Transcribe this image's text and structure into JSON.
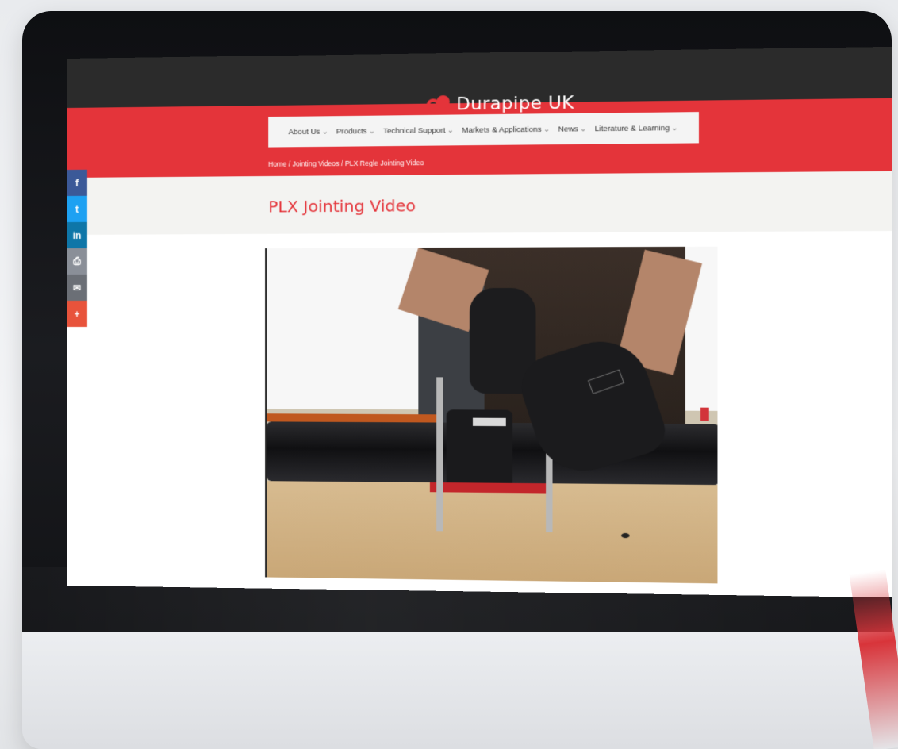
{
  "header": {
    "brand_name": "Durapipe UK",
    "brand_color": "#e4343a"
  },
  "nav": {
    "items": [
      {
        "label": "About Us",
        "caret": "⌄"
      },
      {
        "label": "Products",
        "caret": "⌄"
      },
      {
        "label": "Technical Support",
        "caret": "⌄"
      },
      {
        "label": "Markets & Applications",
        "caret": "⌄"
      },
      {
        "label": "News",
        "caret": "⌄"
      },
      {
        "label": "Literature & Learning",
        "caret": "⌄"
      }
    ]
  },
  "breadcrumb": {
    "home": "Home",
    "section": "Jointing Videos",
    "current": "PLX Regle Jointing Video",
    "separator": "/"
  },
  "page": {
    "title": "PLX Jointing Video"
  },
  "share": {
    "facebook": "f",
    "twitter": "t",
    "linkedin": "in",
    "print": "⎙",
    "email": "✉",
    "more": "+"
  },
  "video": {
    "icon": "video-frame"
  }
}
